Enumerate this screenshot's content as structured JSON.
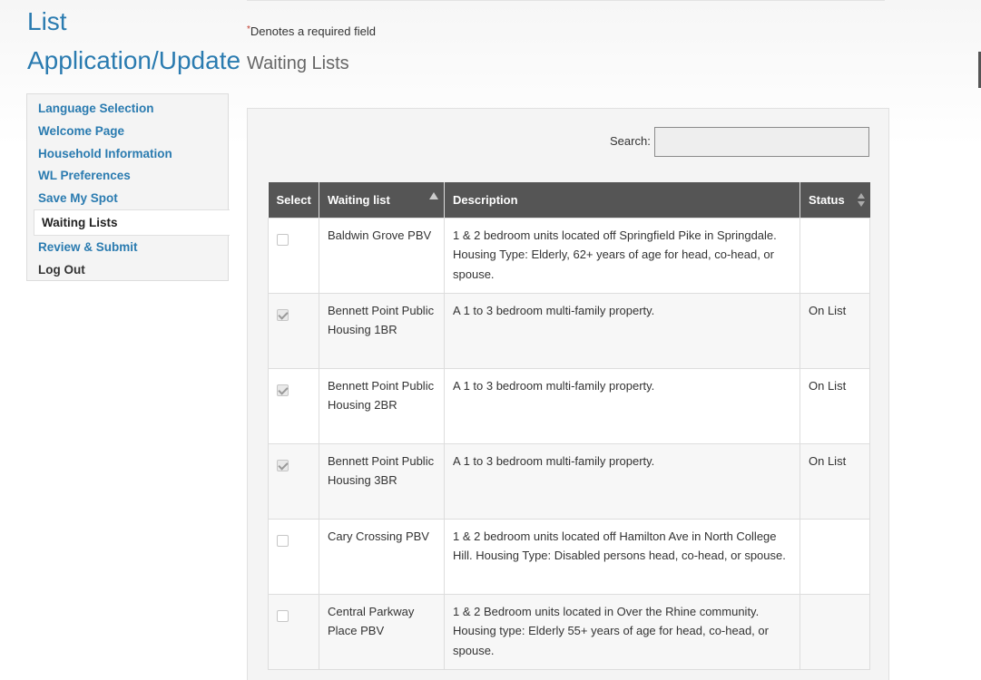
{
  "page": {
    "title": "List Application/Update",
    "required_marker": "*",
    "required_note": "Denotes a required field",
    "section_title": "Waiting Lists"
  },
  "sidebar": {
    "items": [
      {
        "label": "Language Selection"
      },
      {
        "label": "Welcome Page"
      },
      {
        "label": "Household Information"
      },
      {
        "label": "WL Preferences"
      },
      {
        "label": "Save My Spot"
      },
      {
        "label": "Waiting Lists"
      },
      {
        "label": "Review & Submit"
      },
      {
        "label": "Log Out"
      }
    ],
    "active": "Waiting Lists"
  },
  "search": {
    "label": "Search:",
    "value": ""
  },
  "table": {
    "headers": [
      "Select",
      "Waiting list",
      "Description",
      "Status"
    ],
    "sort": {
      "waiting_list": "ascending",
      "status": "unsorted"
    },
    "rows": [
      {
        "selected": false,
        "name": "Baldwin Grove PBV",
        "description": "1 & 2 bedroom units located off Springfield Pike in Springdale. Housing Type: Elderly, 62+ years of age for head, co-head, or spouse.",
        "status": ""
      },
      {
        "selected": true,
        "name": "Bennett Point Public Housing 1BR",
        "description": "A 1 to 3 bedroom multi-family property.",
        "status": "On List"
      },
      {
        "selected": true,
        "name": "Bennett Point Public Housing 2BR",
        "description": "A 1 to 3 bedroom multi-family property.",
        "status": "On List"
      },
      {
        "selected": true,
        "name": "Bennett Point Public Housing 3BR",
        "description": "A 1 to 3 bedroom multi-family property.",
        "status": "On List"
      },
      {
        "selected": false,
        "name": "Cary Crossing PBV",
        "description": "1 & 2 bedroom units located off Hamilton Ave in North College Hill. Housing Type: Disabled persons head, co-head, or spouse.",
        "status": ""
      },
      {
        "selected": false,
        "name": "Central Parkway Place PBV",
        "description": "1 & 2 Bedroom units located in Over the Rhine community. Housing type: Elderly 55+ years of age for head, co-head, or spouse.",
        "status": ""
      }
    ]
  },
  "colors": {
    "link": "#2a7bb0",
    "header_bg": "#555555",
    "panel_bg": "#f4f4f4"
  }
}
